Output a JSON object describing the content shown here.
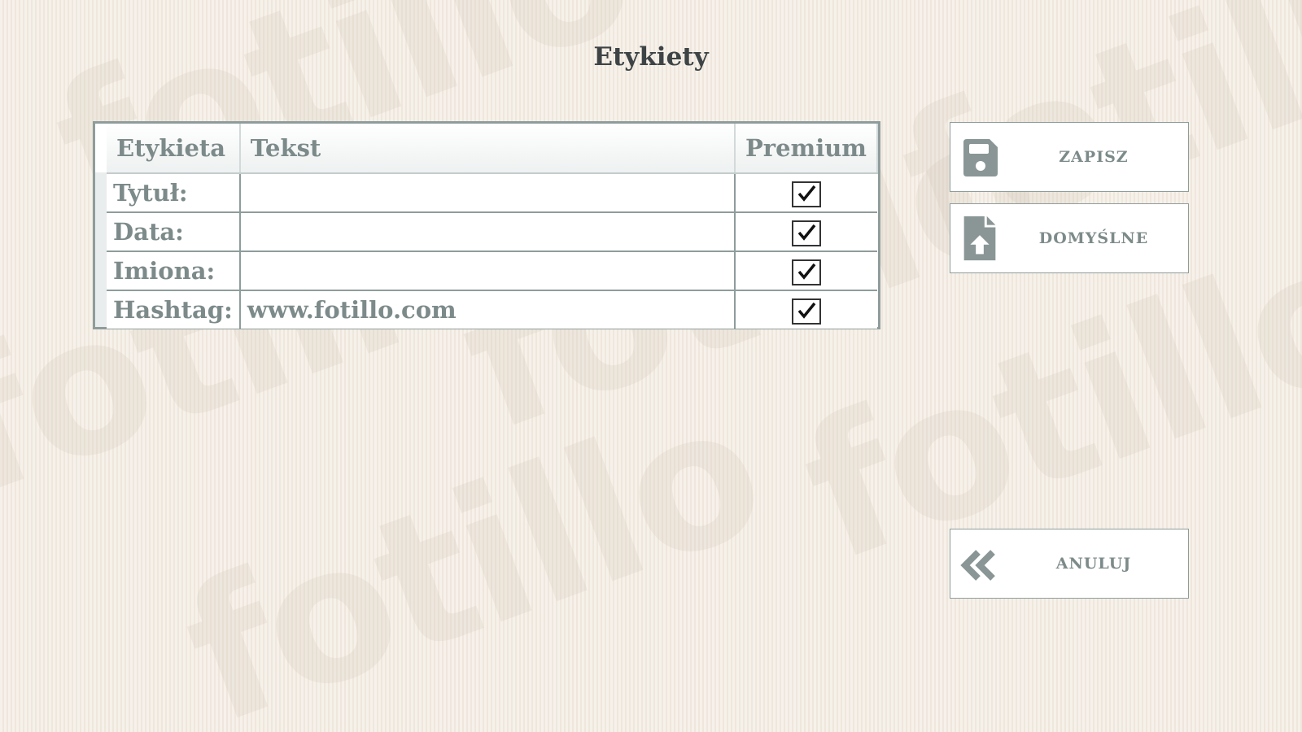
{
  "page_title": "Etykiety",
  "table": {
    "headers": {
      "label": "Etykieta",
      "text": "Tekst",
      "premium": "Premium"
    },
    "rows": [
      {
        "label": "Tytuł:",
        "text": "",
        "premium": true
      },
      {
        "label": "Data:",
        "text": "",
        "premium": true
      },
      {
        "label": "Imiona:",
        "text": "",
        "premium": true
      },
      {
        "label": "Hashtag:",
        "text": "www.fotillo.com",
        "premium": true
      }
    ]
  },
  "buttons": {
    "save": {
      "label": "ZAPISZ",
      "icon": "floppy-disk-icon"
    },
    "defaults": {
      "label": "DOMYŚLNE",
      "icon": "file-upload-icon"
    },
    "cancel": {
      "label": "ANULUJ",
      "icon": "double-chevron-left-icon"
    }
  },
  "watermark": "fotillo",
  "colors": {
    "accent_gray": "#7d8a8a",
    "icon_gray": "#8a9696",
    "border": "#8f9c9c"
  }
}
